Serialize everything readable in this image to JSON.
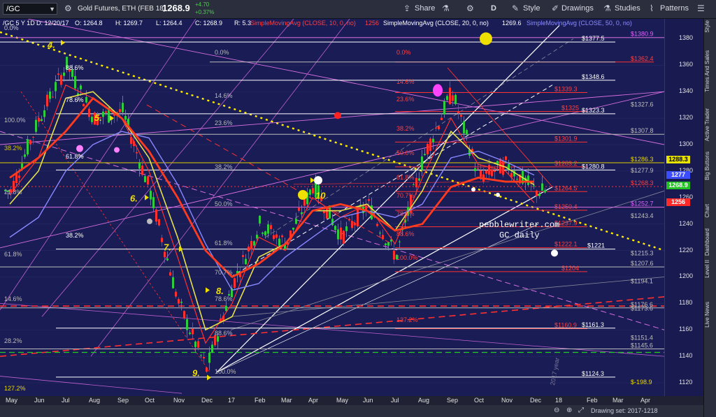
{
  "toolbar": {
    "symbol": "/GC",
    "instrument": "Gold Futures, ETH (FEB 18)",
    "last": "1268.9",
    "change": "+4.70",
    "change_pct": "+0.37%",
    "share": "Share",
    "interval": "D",
    "style": "Style",
    "drawings": "Drawings",
    "studies": "Studies",
    "patterns": "Patterns"
  },
  "header": {
    "title": "/GC 5 Y 1D",
    "date": "D: 12/20/17",
    "open": "O: 1264.8",
    "high": "H: 1269.7",
    "low": "L: 1264.4",
    "close": "C: 1268.9",
    "range": "R: 5.3",
    "sma10": "SimpleMovingAvg (CLOSE, 10, 0, no)",
    "sma10_val": "1256",
    "sma20": "SimpleMovingAvg (CLOSE, 20, 0, no)",
    "sma20_val": "1269.6",
    "sma50": "SimpleMovingAvg (CLOSE, 50, 0, no)"
  },
  "watermark": [
    "pebblewriter.com",
    "GC daily"
  ],
  "channel_label": "2017 year",
  "y_ticks": [
    "1380",
    "1360",
    "1340",
    "1320",
    "1300",
    "1280",
    "1260",
    "1240",
    "1220",
    "1200",
    "1180",
    "1160",
    "1140",
    "1120"
  ],
  "x_ticks": [
    "May",
    "Jun",
    "Jul",
    "Aug",
    "Sep",
    "Oct",
    "Nov",
    "Dec",
    "17",
    "Feb",
    "Mar",
    "Apr",
    "May",
    "Jun",
    "Jul",
    "Aug",
    "Sep",
    "Oct",
    "Nov",
    "Dec",
    "18",
    "Feb",
    "Mar",
    "Apr"
  ],
  "price_tags": [
    {
      "value": "1288.3",
      "bg": "#e8e300",
      "fg": "#000000"
    },
    {
      "value": "1277",
      "bg": "#3b4dff",
      "fg": "#ffffff"
    },
    {
      "value": "1268.9",
      "bg": "#22c022",
      "fg": "#ffffff"
    },
    {
      "value": "1256",
      "bg": "#ff2a2a",
      "fg": "#ffffff"
    }
  ],
  "footer": {
    "drawing_set": "Drawing set: 2017-1218"
  },
  "sidebar": [
    "Style",
    "Times And Sales",
    "Active Trader",
    "Big Buttons",
    "Chart",
    "Dashboard",
    "Level II",
    "Live News"
  ],
  "chart_data": {
    "type": "line",
    "x": [
      "2016-05",
      "2016-06",
      "2016-07",
      "2016-08",
      "2016-09",
      "2016-10",
      "2016-11",
      "2016-12",
      "2017-01",
      "2017-02",
      "2017-03",
      "2017-04",
      "2017-05",
      "2017-06",
      "2017-07",
      "2017-08",
      "2017-09",
      "2017-10",
      "2017-11",
      "2017-12"
    ],
    "series": [
      {
        "name": "/GC",
        "values": [
          1265,
          1320,
          1360,
          1320,
          1325,
          1265,
          1180,
          1130,
          1195,
          1240,
          1225,
          1270,
          1230,
          1255,
          1215,
          1290,
          1340,
          1275,
          1285,
          1265
        ]
      },
      {
        "name": "SimpleMovingAvg (CLOSE, 10, 0, no)",
        "values": [
          1262,
          1290,
          1345,
          1335,
          1320,
          1280,
          1215,
          1150,
          1180,
          1230,
          1220,
          1260,
          1245,
          1255,
          1225,
          1275,
          1320,
          1285,
          1280,
          1256
        ]
      },
      {
        "name": "SimpleMovingAvg (CLOSE, 20, 0, no)",
        "values": [
          1255,
          1280,
          1335,
          1340,
          1320,
          1290,
          1230,
          1160,
          1170,
          1215,
          1225,
          1250,
          1250,
          1255,
          1235,
          1265,
          1310,
          1290,
          1283,
          1269.6
        ]
      },
      {
        "name": "SimpleMovingAvg (CLOSE, 50, 0, no)",
        "values": [
          1230,
          1245,
          1280,
          1300,
          1310,
          1305,
          1270,
          1225,
          1190,
          1195,
          1215,
          1230,
          1245,
          1250,
          1245,
          1255,
          1290,
          1295,
          1287,
          1277
        ]
      }
    ],
    "ylim": [
      1110,
      1395
    ],
    "levels": [
      {
        "value": 1377.5,
        "label": "$1377.5"
      },
      {
        "value": 1380.9,
        "label": "$1380.9"
      },
      {
        "value": 1362.4,
        "label": "$1362.4"
      },
      {
        "value": 1348.6,
        "label": "$1348.6"
      },
      {
        "value": 1339.3,
        "label": "$1339.3"
      },
      {
        "value": 1327.6,
        "label": "$1327.6"
      },
      {
        "value": 1325,
        "label": "$1325"
      },
      {
        "value": 1323.3,
        "label": "$1323.3"
      },
      {
        "value": 1307.8,
        "label": "$1307.8"
      },
      {
        "value": 1301.9,
        "label": "$1301.9"
      },
      {
        "value": 1286.3,
        "label": "$1286.3"
      },
      {
        "value": 1283.2,
        "label": "$1283.2"
      },
      {
        "value": 1280.8,
        "label": "$1280.8"
      },
      {
        "value": 1277.9,
        "label": "$1277.9"
      },
      {
        "value": 1268.3,
        "label": "$1268.3"
      },
      {
        "value": 1264.5,
        "label": "$1264.5"
      },
      {
        "value": 1252.7,
        "label": "$1252.7"
      },
      {
        "value": 1250.4,
        "label": "$1250.4"
      },
      {
        "value": 1243.4,
        "label": "$1243.4"
      },
      {
        "value": 1237.9,
        "label": "$1237.9"
      },
      {
        "value": 1222.1,
        "label": "$1222.1"
      },
      {
        "value": 1221,
        "label": "$1221"
      },
      {
        "value": 1215.3,
        "label": "$1215.3"
      },
      {
        "value": 1207.6,
        "label": "$1207.6"
      },
      {
        "value": 1204,
        "label": "$1204"
      },
      {
        "value": 1194.1,
        "label": "$1194.1"
      },
      {
        "value": 1176.6,
        "label": "$1176.6"
      },
      {
        "value": 1173.6,
        "label": "$1173.6"
      },
      {
        "value": 1161.3,
        "label": "$1161.3"
      },
      {
        "value": 1160.9,
        "label": "$1160.9"
      },
      {
        "value": 1151.4,
        "label": "$1151.4"
      },
      {
        "value": 1145.6,
        "label": "$1145.6"
      },
      {
        "value": 1124.3,
        "label": "$1124.3"
      },
      {
        "value": -198.9,
        "label": "$-198.9"
      }
    ],
    "fib_pct": [
      "0.0%",
      "88.6%",
      "78.6%",
      "100.0%",
      "38.2%",
      "61.8%",
      "21.8%",
      "38.2%",
      "61.8%",
      "14.6%",
      "28.2%",
      "127.2%",
      "0.0%",
      "14.6%",
      "23.6%",
      "38.2%",
      "50.0%",
      "61.8%",
      "70.7%",
      "78.6%",
      "88.6%",
      "100.0%",
      "0.0%",
      "14.6%",
      "23.6%",
      "38.2%",
      "50.0%",
      "61.8%",
      "70.7%",
      "78.6%",
      "88.6%",
      "100.0%",
      "127.2%"
    ],
    "wave_labels": [
      "4.",
      "5.",
      "6.",
      "7.",
      "8.",
      "9.",
      "10"
    ]
  }
}
